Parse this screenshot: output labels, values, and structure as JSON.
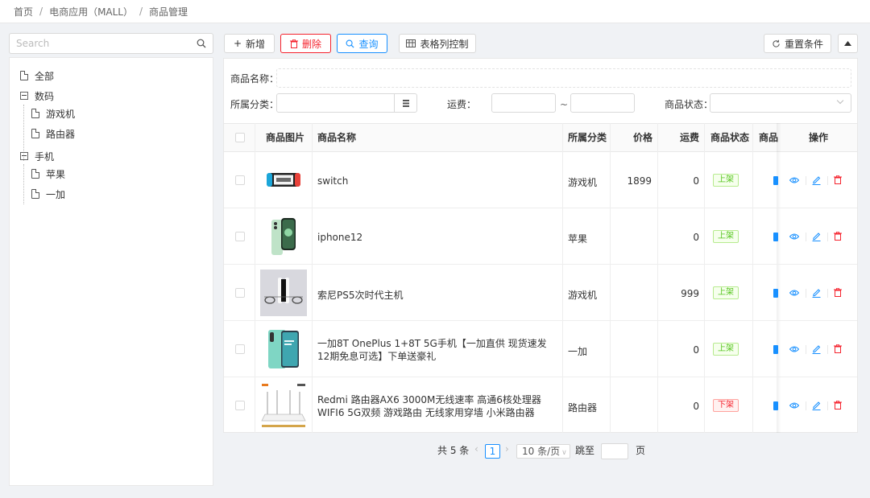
{
  "breadcrumb": [
    "首页",
    "电商应用（MALL）",
    "商品管理"
  ],
  "tree": {
    "search_placeholder": "Search",
    "nodes": [
      {
        "label": "全部",
        "type": "file"
      },
      {
        "label": "数码",
        "type": "folder-open"
      },
      {
        "label": "游戏机",
        "type": "file"
      },
      {
        "label": "路由器",
        "type": "file"
      },
      {
        "label": "手机",
        "type": "folder-open"
      },
      {
        "label": "苹果",
        "type": "file"
      },
      {
        "label": "一加",
        "type": "file"
      }
    ]
  },
  "toolbar": {
    "add": "新增",
    "delete": "删除",
    "query": "查询",
    "columns": "表格列控制",
    "reset": "重置条件"
  },
  "filters": {
    "name_label": "商品名称：",
    "category_label": "所属分类：",
    "shipping_label": "运费：",
    "range_sep": "~",
    "status_label": "商品状态："
  },
  "table": {
    "headers": [
      "商品图片",
      "商品名称",
      "所属分类",
      "价格",
      "运费",
      "商品状态",
      "商品:",
      "操作"
    ],
    "rows": [
      {
        "image": "switch",
        "name": "switch",
        "category": "游戏机",
        "price": "1899",
        "shipping": "0",
        "status": "上架",
        "status_type": "on"
      },
      {
        "image": "iphone",
        "name": "iphone12",
        "category": "苹果",
        "price": "",
        "shipping": "0",
        "status": "上架",
        "status_type": "on"
      },
      {
        "image": "ps5",
        "name": "索尼PS5次时代主机",
        "category": "游戏机",
        "price": "",
        "shipping": "999",
        "status": "上架",
        "status_type": "on"
      },
      {
        "image": "oneplus",
        "name": "一加8T OnePlus 1+8T 5G手机【一加直供 现货速发 12期免息可选】下单送豪礼",
        "category": "一加",
        "price": "",
        "shipping": "0",
        "status": "上架",
        "status_type": "on"
      },
      {
        "image": "router",
        "name": "Redmi 路由器AX6 3000M无线速率 高通6核处理器 WIFI6 5G双频 游戏路由 无线家用穿墙 小米路由器",
        "category": "路由器",
        "price": "",
        "shipping": "0",
        "status": "下架",
        "status_type": "off"
      }
    ]
  },
  "pagination": {
    "total": "共 5 条",
    "current": "1",
    "page_size": "10 条/页",
    "jump_label": "跳至",
    "page_unit": "页"
  },
  "colors": {
    "primary": "#1890ff",
    "danger": "#f5222d",
    "success": "#52c41a"
  }
}
